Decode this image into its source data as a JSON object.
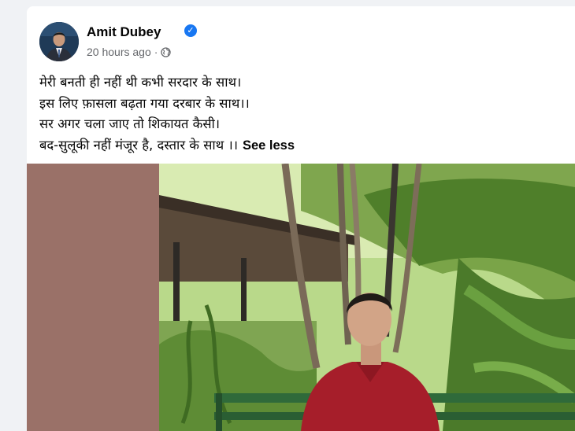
{
  "post": {
    "author": "Amit Dubey",
    "timestamp": "20 hours ago",
    "separator": "·",
    "verified_icon": "verified-check-icon",
    "audience_icon": "globe-icon",
    "lines": [
      "मेरी बनती ही नहीं थी कभी सरदार के साथ।",
      "इस लिए फ़ासला बढ़ता गया दरबार के साथ।।",
      "सर अगर चला जाए तो शिकायत कैसी।",
      " बद-सुलूकी नहीं मंजूर है, दस्तार के साथ ।।"
    ],
    "see_less": "See less"
  },
  "colors": {
    "page_bg": "#f0f2f5",
    "card_bg": "#ffffff",
    "verified": "#1877f2",
    "muted_text": "#65676b",
    "media_left_panel": "#9a7168"
  }
}
